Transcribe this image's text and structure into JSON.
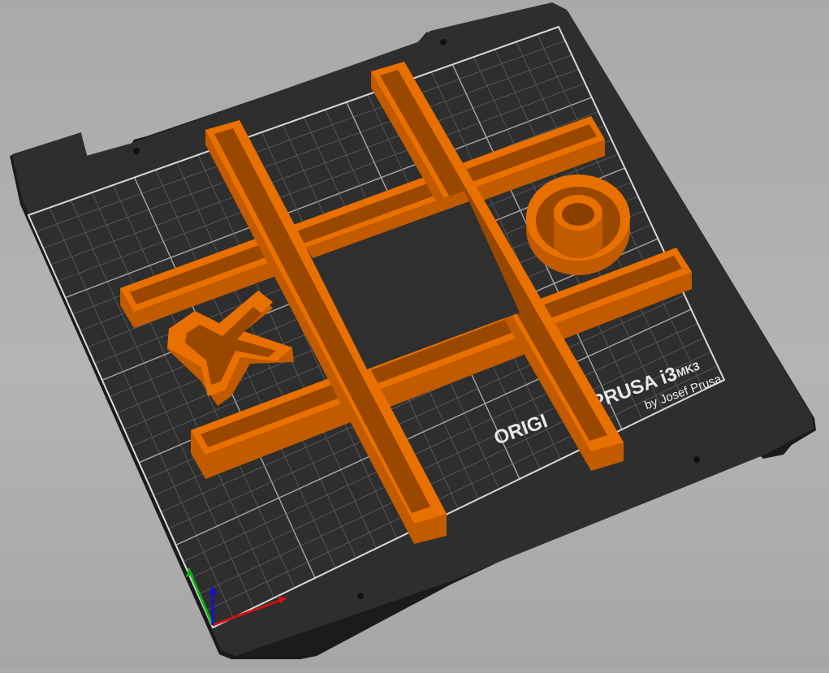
{
  "bed": {
    "label_line1": "ORIGINAL PRUSA i3",
    "label_line1_part1": "ORIGI",
    "label_line1_part2": "PRUSA i3",
    "label_mk": "MK3",
    "label_line2": "by Josef Prusa"
  },
  "colors": {
    "background": "#b0b0b0",
    "bed_plate": "#2a2a2a",
    "grid_line": "#6a6a6a",
    "model_top": "#e87000",
    "model_side": "#c25a00",
    "model_inner": "#9a4700",
    "axis_x": "#d01010",
    "axis_y": "#10b010",
    "axis_z": "#1010d0"
  },
  "objects": [
    {
      "name": "tic-tac-toe-grid"
    },
    {
      "name": "x-piece"
    },
    {
      "name": "o-piece"
    }
  ],
  "icons": [
    "axis-gizmo-icon"
  ]
}
